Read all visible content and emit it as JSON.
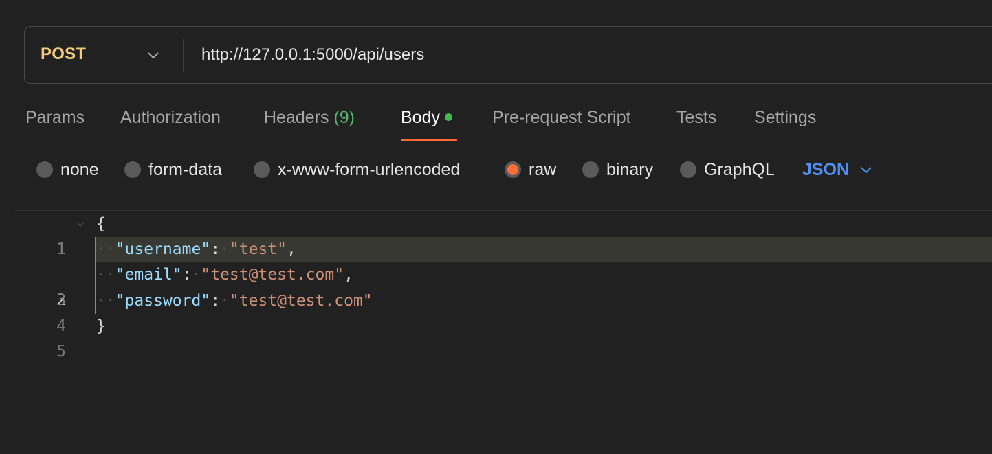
{
  "request": {
    "method": "POST",
    "url": "http://127.0.0.1:5000/api/users"
  },
  "tabs": [
    {
      "label": "Params"
    },
    {
      "label": "Authorization"
    },
    {
      "label": "Headers",
      "count": "(9)"
    },
    {
      "label": "Body",
      "active": true
    },
    {
      "label": "Pre-request Script"
    },
    {
      "label": "Tests"
    },
    {
      "label": "Settings"
    }
  ],
  "body_types": [
    {
      "label": "none"
    },
    {
      "label": "form-data"
    },
    {
      "label": "x-www-form-urlencoded"
    },
    {
      "label": "raw",
      "selected": true
    },
    {
      "label": "binary"
    },
    {
      "label": "GraphQL"
    }
  ],
  "raw_format": "JSON",
  "editor": {
    "line_numbers": [
      "1",
      "2",
      "3",
      "4",
      "5"
    ],
    "open_brace": "{",
    "close_brace": "}",
    "fields": [
      {
        "key": "\"username\"",
        "value": "\"test\"",
        "trail": ","
      },
      {
        "key": "\"email\"",
        "value": "\"test@test.com\"",
        "trail": ","
      },
      {
        "key": "\"password\"",
        "value": "\"test@test.com\"",
        "trail": ""
      }
    ],
    "colon": ":"
  },
  "colors": {
    "method": "#f2cc7a",
    "accent": "#ff6c37",
    "json_link": "#4e8ff0",
    "header_count": "#56b46a",
    "body_dot": "#3fb950",
    "json_key": "#9cdcfe",
    "json_string": "#ce9178"
  },
  "icons": {
    "method_dropdown": "chevron-down-icon",
    "format_dropdown": "chevron-down-icon",
    "fold": "fold-chevron-icon"
  }
}
